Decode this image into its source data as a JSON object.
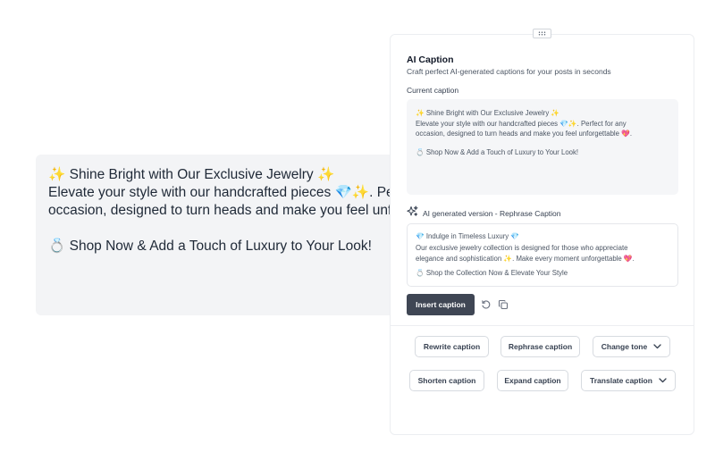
{
  "editor": {
    "lines": [
      "✨ Shine Bright with Our Exclusive Jewelry ✨",
      "Elevate your style with our handcrafted pieces 💎✨. Perfect for any",
      "occasion, designed to turn heads and make you feel unforgettable 💖.",
      "💍 Shop Now & Add a Touch of Luxury to Your Look!"
    ]
  },
  "panel": {
    "title": "AI Caption",
    "subtitle": "Craft perfect AI-generated captions for your posts in seconds",
    "current_label": "Current caption",
    "current_lines": [
      "✨ Shine Bright with Our Exclusive Jewelry ✨",
      "Elevate your style with our handcrafted pieces 💎✨. Perfect for any",
      "occasion, designed to turn heads and make you feel unforgettable 💖.",
      "💍 Shop Now & Add a Touch of Luxury to Your Look!"
    ],
    "generated_label": "AI generated version - Rephrase Caption",
    "generated_lines": [
      "💎 Indulge in Timeless Luxury 💎",
      "Our exclusive jewelry collection is designed for those who appreciate",
      "elegance and sophistication ✨. Make every moment unforgettable 💖.",
      "💍 Shop the Collection Now & Elevate Your Style"
    ],
    "insert_label": "Insert caption",
    "buttons": {
      "rewrite": "Rewrite caption",
      "rephrase": "Rephrase caption",
      "change_tone": "Change tone",
      "shorten": "Shorten caption",
      "expand": "Expand caption",
      "translate": "Translate caption"
    }
  },
  "icons": {
    "drag": "drag-handle-icon",
    "sparkle": "sparkles-icon",
    "regenerate": "refresh-icon",
    "copy": "copy-icon",
    "dropdown": "chevron-down-icon"
  },
  "colors": {
    "insert_button": "#3f4654",
    "editor_bg": "#f3f4f6",
    "box_bg": "#f5f6f8"
  }
}
